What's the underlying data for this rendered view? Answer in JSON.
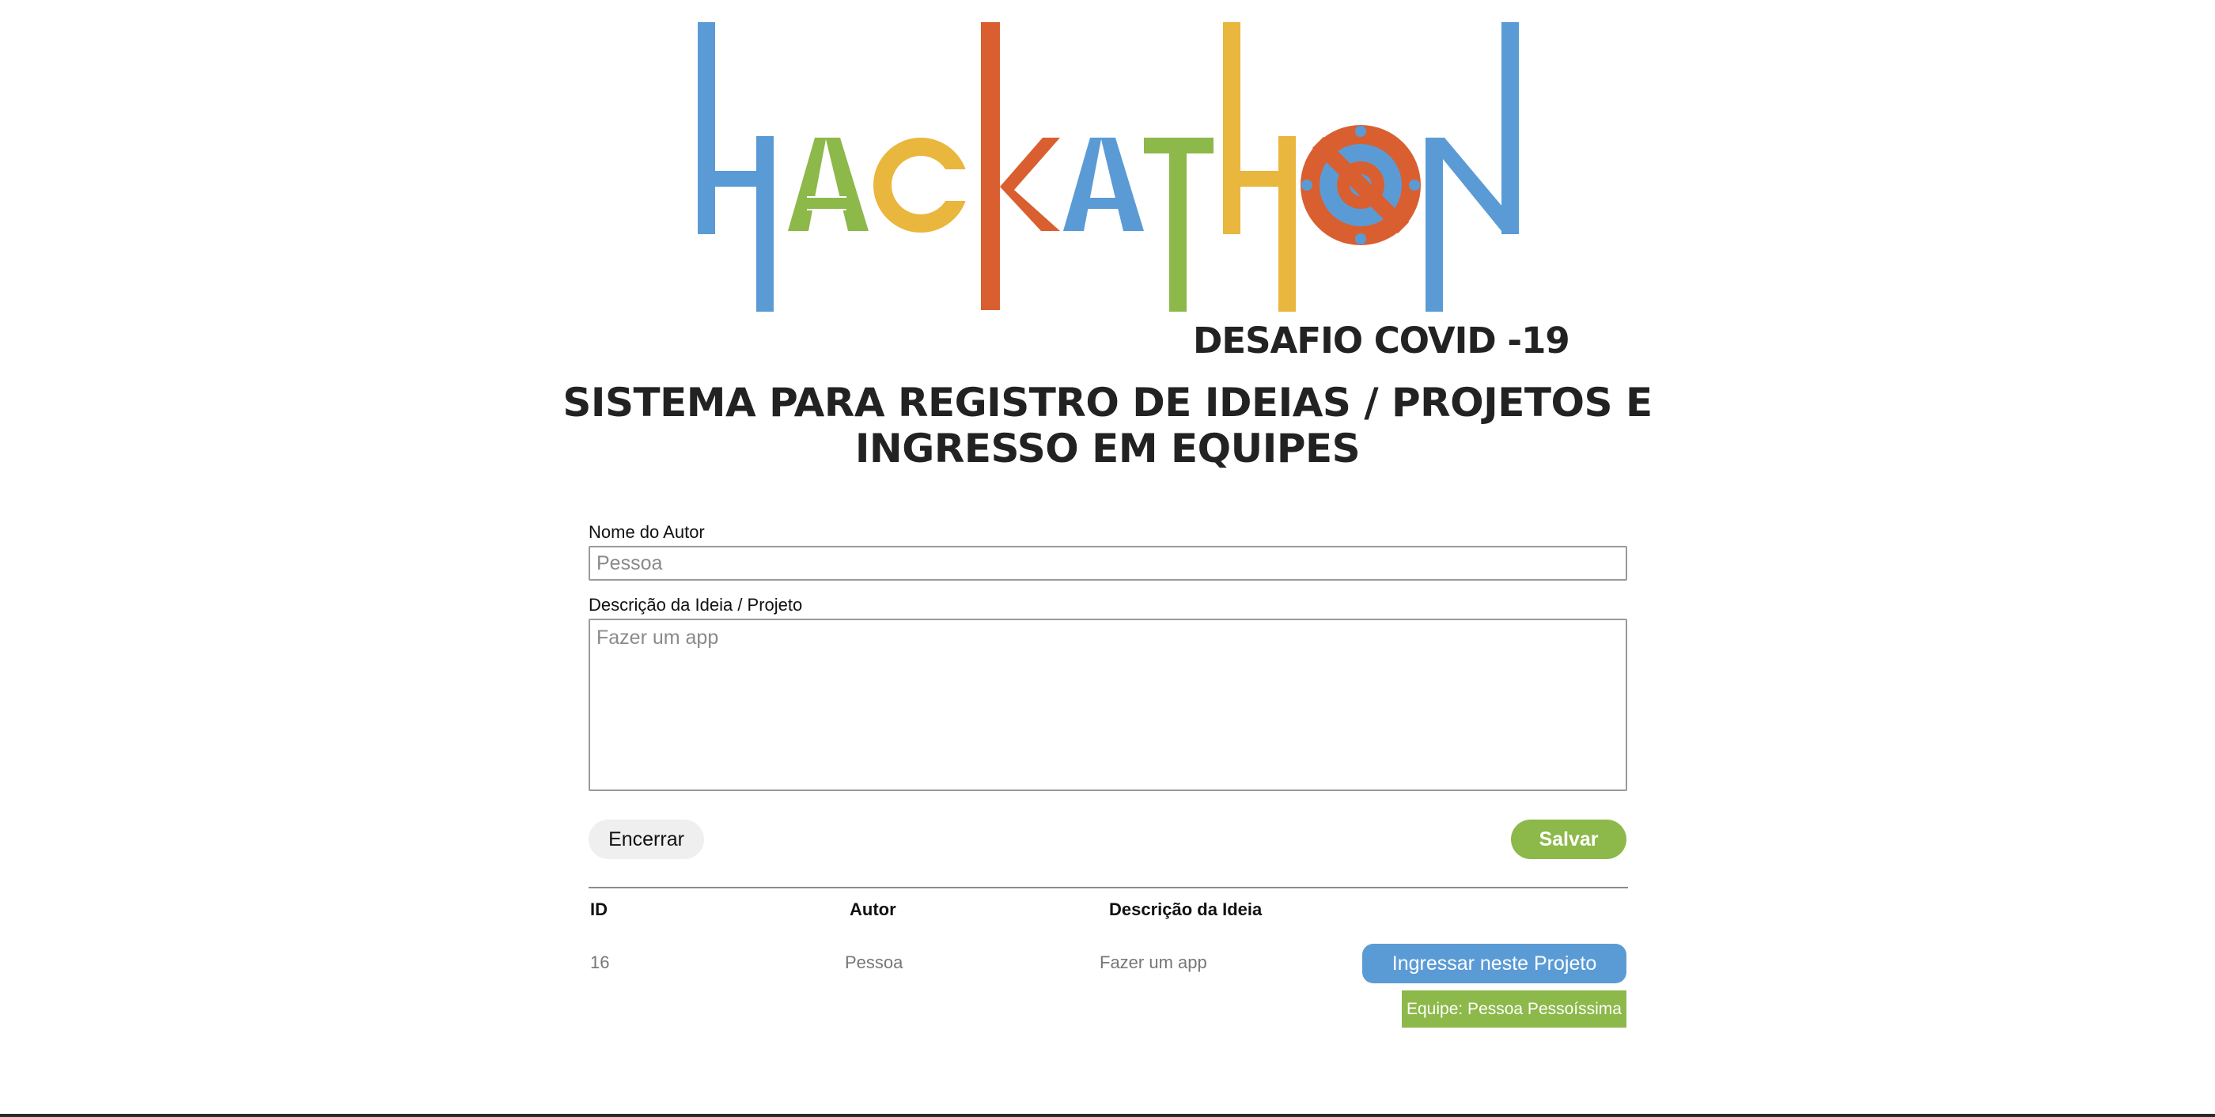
{
  "logo": {
    "wordmark": "HACKATHON",
    "subtitle": "DESAFIO COVID -19",
    "icon": "no-virus-icon",
    "colors": {
      "blue": "#5b9bd5",
      "green": "#8db84a",
      "orange": "#d95f30",
      "yellow": "#e9b63e"
    }
  },
  "page": {
    "title": "SISTEMA PARA REGISTRO DE IDEIAS / PROJETOS E INGRESSO EM EQUIPES"
  },
  "form": {
    "author_label": "Nome do Autor",
    "author_placeholder": "Pessoa",
    "description_label": "Descrição da Ideia / Projeto",
    "description_placeholder": "Fazer um app",
    "end_button": "Encerrar",
    "save_button": "Salvar"
  },
  "table": {
    "headers": [
      "ID",
      "Autor",
      "Descrição da Ideia"
    ],
    "rows": [
      {
        "id": "16",
        "author": "Pessoa",
        "description": "Fazer um app",
        "join_button": "Ingressar neste Projeto",
        "team": "Equipe: Pessoa Pessoíssima"
      }
    ]
  },
  "theme": {
    "accent_green": "#8db84a",
    "accent_blue": "#5b9bd5",
    "text_dark": "#222222",
    "text_muted": "#777777"
  }
}
